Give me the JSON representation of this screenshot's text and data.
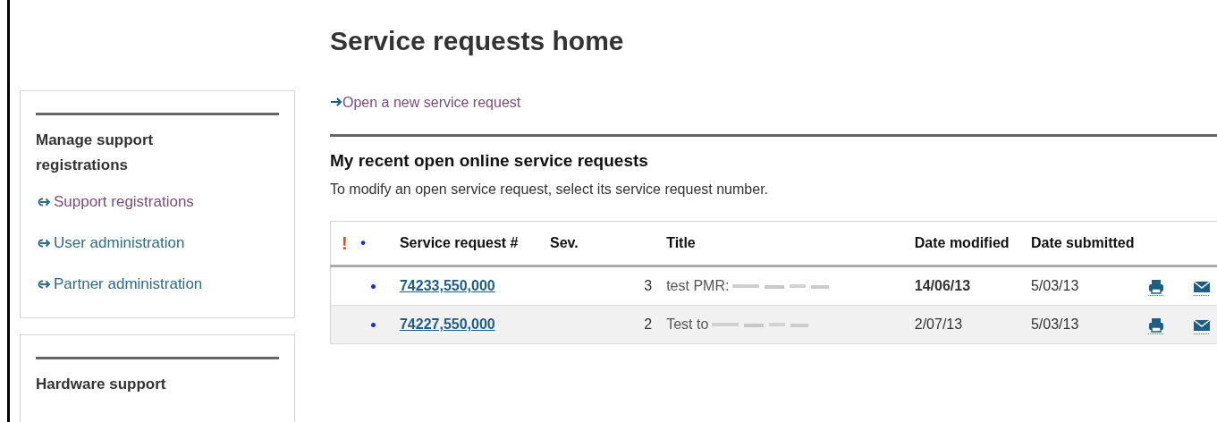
{
  "page": {
    "title": "Service requests home"
  },
  "sidebar": {
    "boxes": [
      {
        "heading": "Manage support registrations",
        "links": [
          {
            "label": "Support registrations",
            "visited": true
          },
          {
            "label": "User administration",
            "visited": false
          },
          {
            "label": "Partner administration",
            "visited": false
          }
        ]
      },
      {
        "heading": "Hardware support"
      }
    ]
  },
  "new_request_link": {
    "label": "Open a new service request",
    "visited": true
  },
  "section": {
    "heading": "My recent open online service requests",
    "instruction": "To modify an open service request, select its service request number."
  },
  "table": {
    "columns": [
      {
        "label": "!",
        "kind": "priority"
      },
      {
        "label": "•",
        "kind": "unread"
      },
      {
        "label": "Service request #",
        "kind": "text"
      },
      {
        "label": "Sev.",
        "kind": "text"
      },
      {
        "label": "Title",
        "kind": "text"
      },
      {
        "label": "Date modified",
        "kind": "text"
      },
      {
        "label": "Date submitted",
        "kind": "text"
      }
    ],
    "rows": [
      {
        "unread": true,
        "number": "74233,550,000",
        "severity": "3",
        "title": "test PMR:",
        "title_redacted": true,
        "date_modified": "14/06/13",
        "date_modified_bold": true,
        "date_submitted": "5/03/13"
      },
      {
        "unread": true,
        "number": "74227,550,000",
        "severity": "2",
        "title": "Test to",
        "title_redacted": true,
        "date_modified": "2/07/13",
        "date_modified_bold": false,
        "date_submitted": "5/03/13"
      }
    ]
  }
}
